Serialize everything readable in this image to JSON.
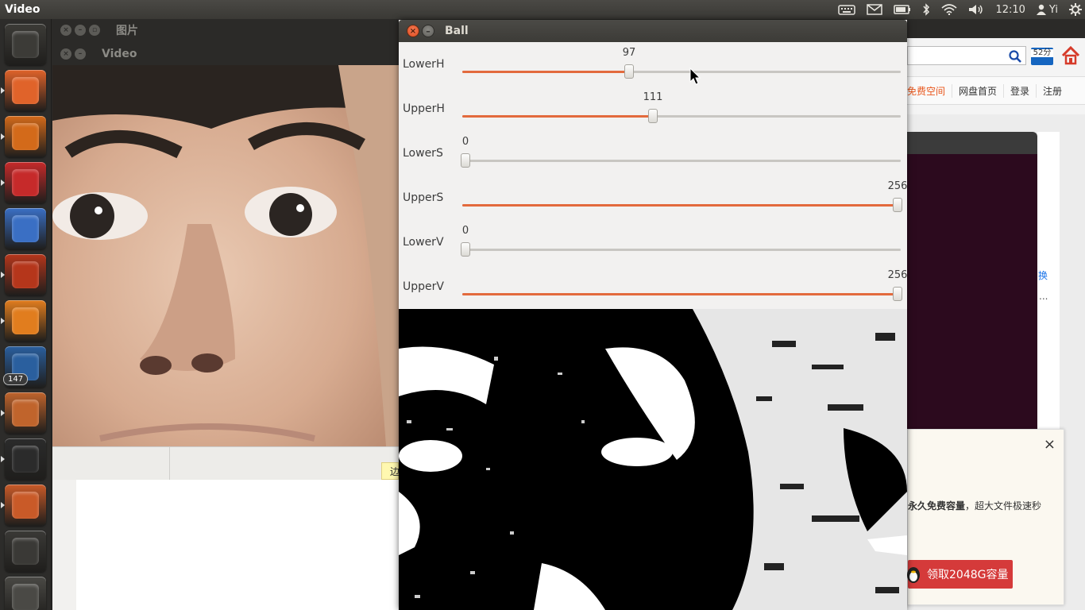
{
  "top_panel": {
    "app_title": "Video",
    "clock": "12:10",
    "user": "Yi"
  },
  "launcher": {
    "items": [
      {
        "name": "dash-home-icon",
        "color": "#3c3b37"
      },
      {
        "name": "files-icon",
        "color": "#e0632a"
      },
      {
        "name": "firefox-icon",
        "color": "#d36a1a"
      },
      {
        "name": "chrome-icon",
        "color": "#c62a2a"
      },
      {
        "name": "bluefish-icon",
        "color": "#3a6fc4"
      },
      {
        "name": "ubuntu-software-icon",
        "color": "#b5361b"
      },
      {
        "name": "vlc-icon",
        "color": "#e17d1e"
      },
      {
        "name": "writer-icon",
        "color": "#2a5f9e"
      },
      {
        "name": "update-manager-icon",
        "color": "#c0642c"
      },
      {
        "name": "terminal-icon",
        "color": "#2b2b2b"
      },
      {
        "name": "video-editor-icon",
        "color": "#c95a28"
      },
      {
        "name": "workspace-switcher-icon",
        "color": "#3a3936"
      },
      {
        "name": "trash-icon",
        "color": "#4a4945"
      }
    ],
    "update_badge": "147"
  },
  "bg_windows": {
    "pictures_title": "图片",
    "video_title": "Video",
    "hint_char": "边"
  },
  "browser": {
    "points_badge": "52分",
    "nav": [
      "免费空间",
      "网盘首页",
      "登录",
      "注册"
    ],
    "side_link": "换",
    "side_dots": "...",
    "popup_text_bold": "永久免费容量",
    "popup_text_rest": "，超大文件极速秒",
    "popup_button": "领取2048G容量",
    "popup_close": "×"
  },
  "ball_window": {
    "title": "Ball",
    "close_glyph": "×",
    "min_glyph": "–",
    "sliders": [
      {
        "label": "LowerH",
        "value": 97,
        "max": 256
      },
      {
        "label": "UpperH",
        "value": 111,
        "max": 256
      },
      {
        "label": "LowerS",
        "value": 0,
        "max": 256
      },
      {
        "label": "UpperS",
        "value": 256,
        "max": 256
      },
      {
        "label": "LowerV",
        "value": 0,
        "max": 256
      },
      {
        "label": "UpperV",
        "value": 256,
        "max": 256
      }
    ]
  }
}
